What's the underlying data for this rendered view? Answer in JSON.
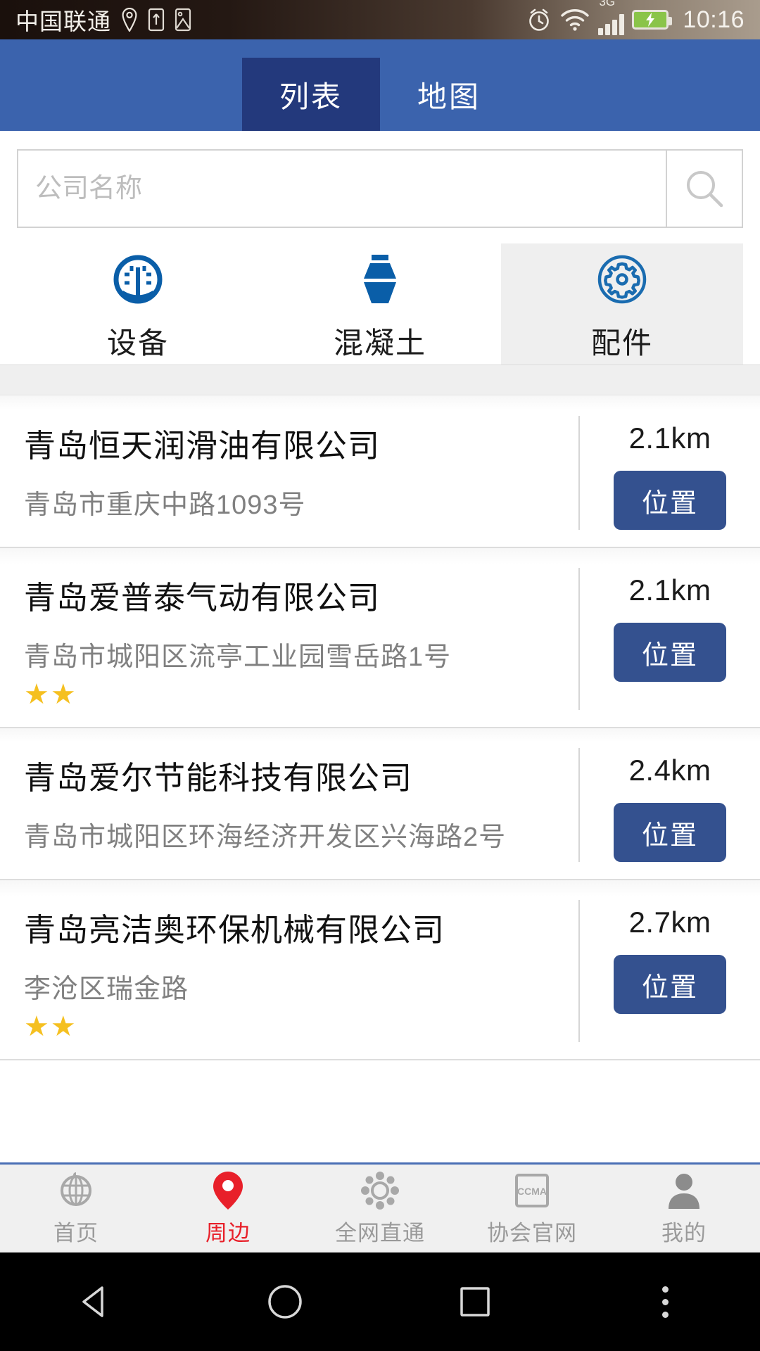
{
  "status_bar": {
    "carrier": "中国联通",
    "time": "10:16",
    "network_type": "3G",
    "icons": [
      "location-icon",
      "sim-card-icon",
      "screenshot-icon",
      "alarm-icon",
      "wifi-icon",
      "signal-icon",
      "battery-charging-icon"
    ],
    "battery_color": "#8ac449"
  },
  "header": {
    "tabs": [
      {
        "label": "列表",
        "active": true
      },
      {
        "label": "地图",
        "active": false
      }
    ],
    "bg_color": "#3b63ad",
    "active_tab_color": "#23397c"
  },
  "search": {
    "placeholder": "公司名称",
    "value": "",
    "icon": "search-icon"
  },
  "categories": [
    {
      "label": "设备",
      "icon": "gauge-icon",
      "selected": false
    },
    {
      "label": "混凝土",
      "icon": "mixer-drum-icon",
      "selected": false
    },
    {
      "label": "配件",
      "icon": "gear-circle-icon",
      "selected": true
    }
  ],
  "category_accent_color": "#0a5ea8",
  "list": [
    {
      "name": "青岛恒天润滑油有限公司",
      "address": "青岛市重庆中路1093号",
      "distance": "2.1km",
      "stars": 0,
      "action_label": "位置"
    },
    {
      "name": "青岛爱普泰气动有限公司",
      "address": "青岛市城阳区流亭工业园雪岳路1号",
      "distance": "2.1km",
      "stars": 2,
      "action_label": "位置"
    },
    {
      "name": "青岛爱尔节能科技有限公司",
      "address": "青岛市城阳区环海经济开发区兴海路2号",
      "distance": "2.4km",
      "stars": 0,
      "action_label": "位置"
    },
    {
      "name": "青岛亮洁奥环保机械有限公司",
      "address": "李沧区瑞金路",
      "distance": "2.7km",
      "stars": 2,
      "action_label": "位置"
    }
  ],
  "star_glyph": "★",
  "star_color": "#f5c020",
  "action_button_color": "#34518f",
  "bottom_nav": [
    {
      "label": "首页",
      "icon": "globe-icon",
      "active": false
    },
    {
      "label": "周边",
      "icon": "map-pin-icon",
      "active": true
    },
    {
      "label": "全网直通",
      "icon": "network-icon",
      "active": false
    },
    {
      "label": "协会官网",
      "icon": "ccma-badge-icon",
      "active": false
    },
    {
      "label": "我的",
      "icon": "person-icon",
      "active": false
    }
  ],
  "bottom_nav_active_color": "#e8202a",
  "system_bar": {
    "buttons": [
      {
        "name": "back",
        "icon": "triangle-back-icon"
      },
      {
        "name": "home",
        "icon": "circle-home-icon"
      },
      {
        "name": "recents",
        "icon": "square-recents-icon"
      },
      {
        "name": "menu",
        "icon": "overflow-dots-icon"
      }
    ]
  }
}
